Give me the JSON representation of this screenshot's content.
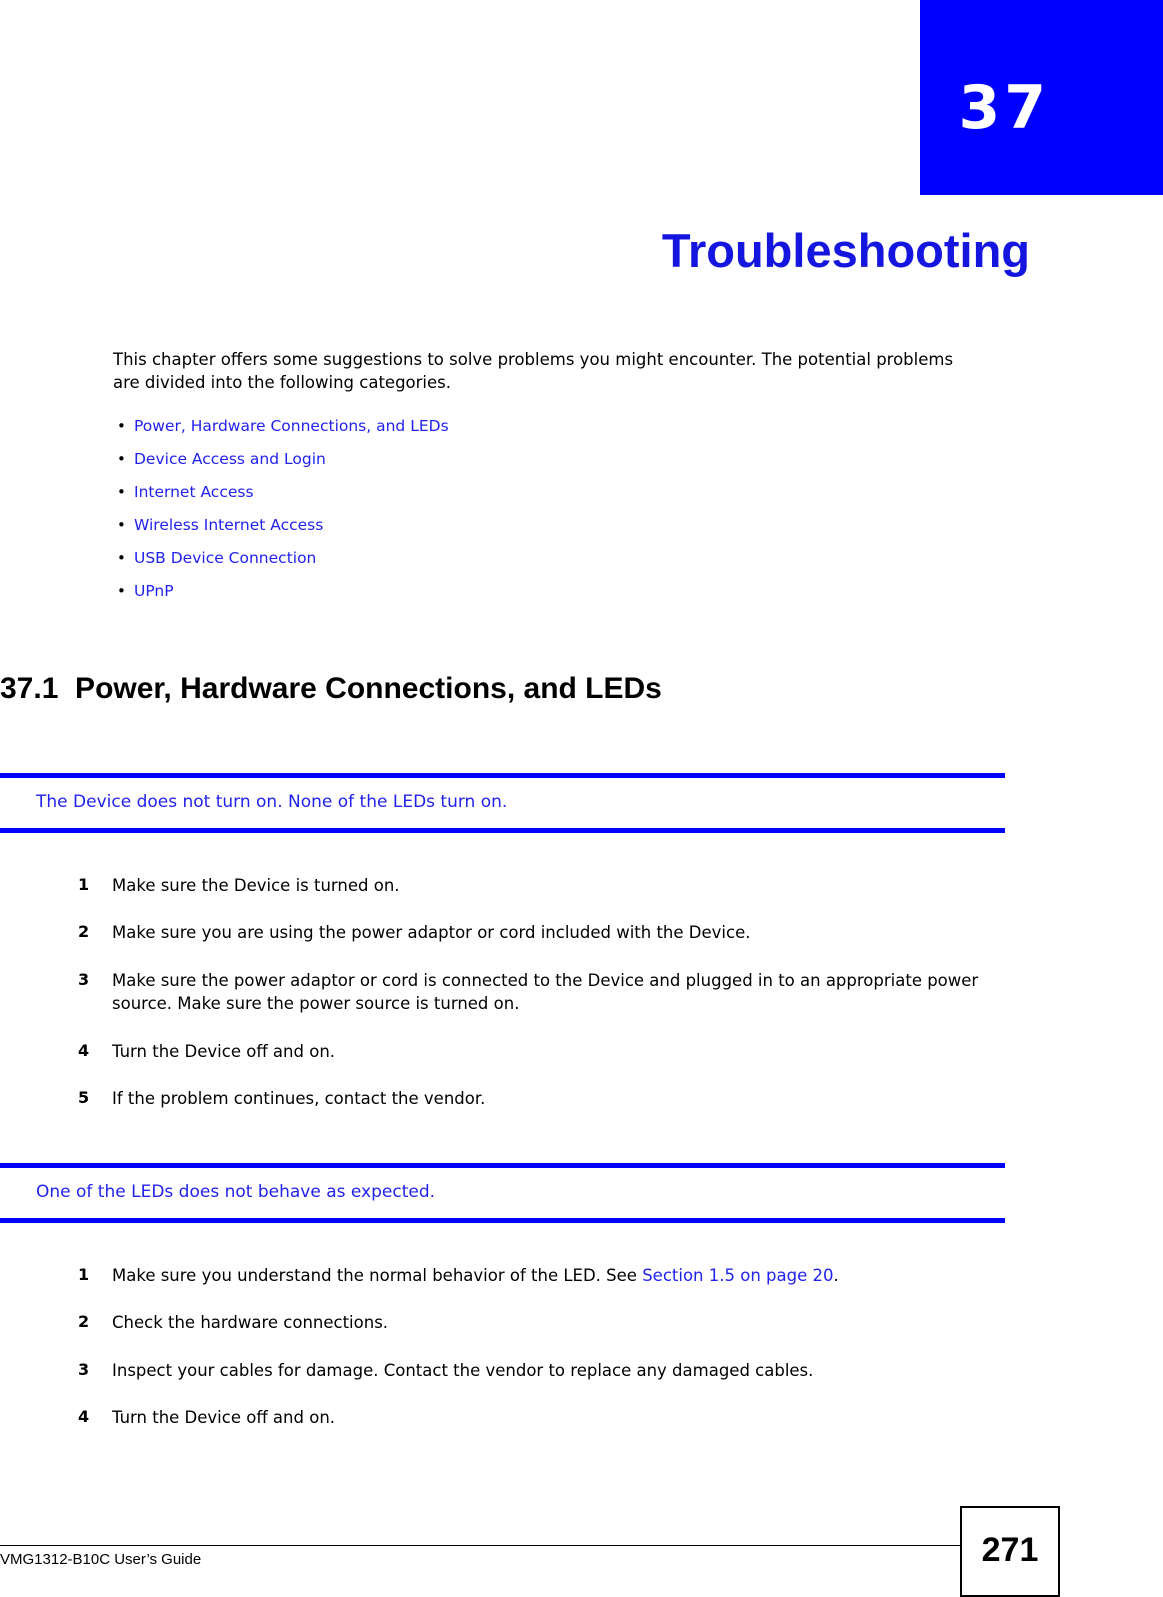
{
  "chapter": {
    "number": "37",
    "title": "Troubleshooting"
  },
  "intro": "This chapter offers some suggestions to solve problems you might encounter. The potential problems are divided into the following categories.",
  "toc": {
    "bullet_glyph": "•",
    "items": [
      {
        "label": "Power, Hardware Connections, and LEDs"
      },
      {
        "label": "Device Access and Login"
      },
      {
        "label": "Internet Access"
      },
      {
        "label": "Wireless Internet Access"
      },
      {
        "label": "USB Device Connection"
      },
      {
        "label": "UPnP"
      }
    ]
  },
  "section": {
    "heading": "37.1  Power, Hardware Connections, and LEDs"
  },
  "questions": [
    {
      "question": "The Device does not turn on. None of the LEDs turn on.",
      "steps": [
        {
          "num": "1",
          "text": "Make sure the Device is turned on."
        },
        {
          "num": "2",
          "text": "Make sure you are using the power adaptor or cord included with the Device."
        },
        {
          "num": "3",
          "text": "Make sure the power adaptor or cord is connected to the Device and plugged in to an appropriate power source. Make sure the power source is turned on."
        },
        {
          "num": "4",
          "text": "Turn the Device off and on."
        },
        {
          "num": "5",
          "text": "If the problem continues, contact the vendor."
        }
      ]
    },
    {
      "question": "One of the LEDs does not behave as expected.",
      "steps": [
        {
          "num": "1",
          "text_before": "Make sure you understand the normal behavior of the LED. See ",
          "link": "Section 1.5 on page 20",
          "text_after": "."
        },
        {
          "num": "2",
          "text": "Check the hardware connections."
        },
        {
          "num": "3",
          "text": "Inspect your cables for damage. Contact the vendor to replace any damaged cables."
        },
        {
          "num": "4",
          "text": "Turn the Device off and on."
        }
      ]
    }
  ],
  "footer": {
    "guide": "VMG1312-B10C User’s Guide",
    "page_number": "271"
  },
  "colors": {
    "brand_blue": "#0000FF",
    "link_blue": "#2222EE",
    "title_blue": "#1515E0"
  }
}
